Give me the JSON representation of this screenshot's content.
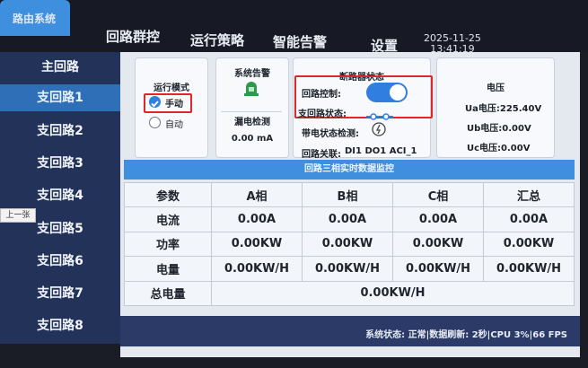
{
  "nav": {
    "active_label": "路由系统",
    "tabs": [
      "回路群控",
      "运行策略",
      "智能告警",
      "设置"
    ],
    "date": "2025-11-25",
    "time": "13:41:19"
  },
  "sidebar": {
    "items": [
      "主回路",
      "支回路1",
      "支回路2",
      "支回路3",
      "支回路4",
      "支回路5",
      "支回路6",
      "支回路7",
      "支回路8"
    ],
    "active_index": 1,
    "prev_page": "上一张"
  },
  "mode_card": {
    "title": "运行模式",
    "manual": "手动",
    "auto": "自动",
    "selected": "手动"
  },
  "alarm_card": {
    "title": "系统告警",
    "leak_title": "漏电检测",
    "leak_value": "0.00 mA"
  },
  "breaker_card": {
    "title": "断路器状态",
    "control_label": "回路控制:",
    "control_state": "on",
    "branch_status_label": "支回路状态:",
    "live_label": "带电状态检测:",
    "relay_label": "回路关联:",
    "relay_value": "DI1 DO1 ACI_1"
  },
  "voltage_card": {
    "title": "电压",
    "ua": "Ua电压:225.40V",
    "ub": "Ub电压:0.00V",
    "uc": "Uc电压:0.00V"
  },
  "monitor": {
    "title": "回路三相实时数据监控",
    "headers": [
      "参数",
      "A相",
      "B相",
      "C相",
      "汇总"
    ],
    "rows": [
      [
        "电流",
        "0.00A",
        "0.00A",
        "0.00A",
        "0.00A"
      ],
      [
        "功率",
        "0.00KW",
        "0.00KW",
        "0.00KW",
        "0.00KW"
      ],
      [
        "电量",
        "0.00KW/H",
        "0.00KW/H",
        "0.00KW/H",
        "0.00KW/H"
      ]
    ],
    "total_label": "总电量",
    "total_value": "0.00KW/H"
  },
  "status_bar": {
    "text": "系统状态: 正常|数据刷新: 2秒|CPU 3%|66 FPS"
  },
  "colors": {
    "accent_blue": "#3f8fde",
    "sidebar_bg": "#223259",
    "annotation_red": "#e0262a",
    "alarm_green": "#2c9a4a"
  }
}
